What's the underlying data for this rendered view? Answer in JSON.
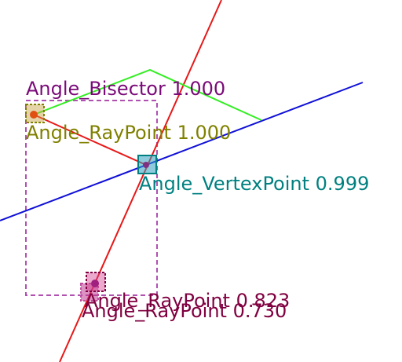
{
  "labels": {
    "bisector": "Angle_Bisector 1.000",
    "raypoint_top": "Angle_RayPoint 1.000",
    "vertex": "Angle_VertexPoint 0.999",
    "raypoint_a": "Angle_RayPoint 0.823",
    "raypoint_b": "Angle_RayPoint 0.730"
  },
  "colors": {
    "red_line": "#e81818",
    "blue_line": "#1010d8",
    "green_line": "#33ee22",
    "bisector": "#7a0a78",
    "raypoint_top": "#808000",
    "vertex": "#008080",
    "raypoint_low": "#800040",
    "dashed_box": "#b050b0"
  }
}
